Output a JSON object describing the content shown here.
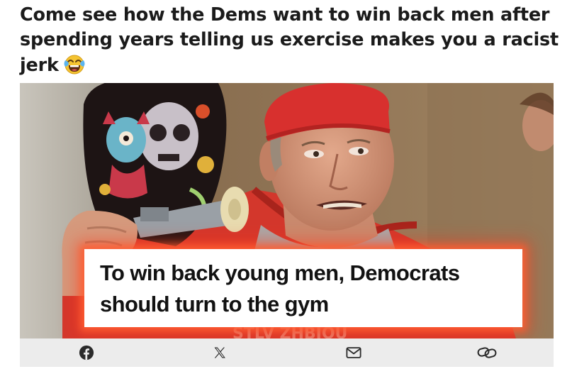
{
  "post": {
    "title": "Come see how the Dems want to win back men after spending years telling us exercise makes you a racist jerk",
    "title_emoji": "face-with-tears-of-joy-icon"
  },
  "meme": {
    "headline": "To win back young men, Democrats should turn to the gym",
    "background_shirt_text": "STLV... ZHBIOU",
    "accent_color": "#ff5a2d"
  },
  "share_bar": {
    "background": "#ececec",
    "buttons": [
      {
        "icon": "facebook-icon"
      },
      {
        "icon": "x-icon"
      },
      {
        "icon": "email-icon"
      },
      {
        "icon": "link-icon"
      }
    ]
  }
}
